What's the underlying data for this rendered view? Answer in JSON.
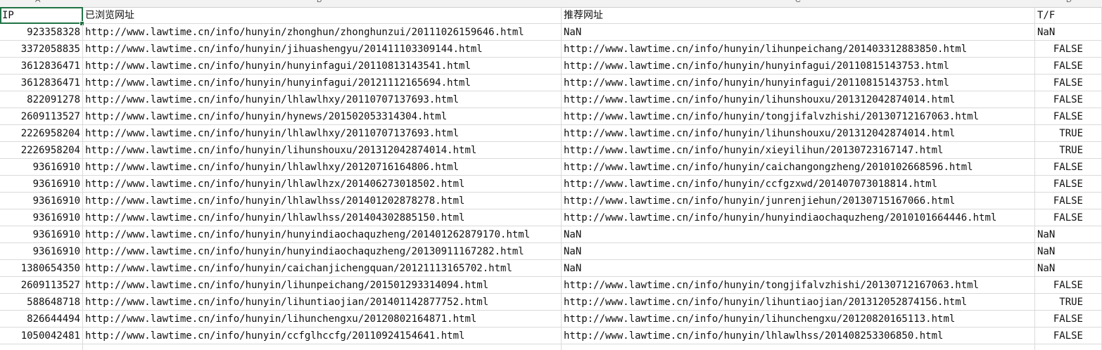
{
  "column_letters": [
    "A",
    "B",
    "C",
    "D"
  ],
  "header": {
    "ip": "IP",
    "viewed": "已浏览网址",
    "recommended": "推荐网址",
    "tf": "T/F"
  },
  "rows": [
    {
      "ip": "923358328",
      "viewed": "http://www.lawtime.cn/info/hunyin/zhonghun/zhonghunzui/20111026159646.html",
      "recommended": "NaN",
      "tf": "NaN"
    },
    {
      "ip": "3372058835",
      "viewed": "http://www.lawtime.cn/info/hunyin/jihuashengyu/201411103309144.html",
      "recommended": "http://www.lawtime.cn/info/hunyin/lihunpeichang/201403312883850.html",
      "tf": "FALSE"
    },
    {
      "ip": "3612836471",
      "viewed": "http://www.lawtime.cn/info/hunyin/hunyinfagui/20110813143541.html",
      "recommended": "http://www.lawtime.cn/info/hunyin/hunyinfagui/20110815143753.html",
      "tf": "FALSE"
    },
    {
      "ip": "3612836471",
      "viewed": "http://www.lawtime.cn/info/hunyin/hunyinfagui/20121112165694.html",
      "recommended": "http://www.lawtime.cn/info/hunyin/hunyinfagui/20110815143753.html",
      "tf": "FALSE"
    },
    {
      "ip": "822091278",
      "viewed": "http://www.lawtime.cn/info/hunyin/lhlawlhxy/20110707137693.html",
      "recommended": "http://www.lawtime.cn/info/hunyin/lihunshouxu/201312042874014.html",
      "tf": "FALSE"
    },
    {
      "ip": "2609113527",
      "viewed": "http://www.lawtime.cn/info/hunyin/hynews/201502053314304.html",
      "recommended": "http://www.lawtime.cn/info/hunyin/tongjifalvzhishi/20130712167063.html",
      "tf": "FALSE"
    },
    {
      "ip": "2226958204",
      "viewed": "http://www.lawtime.cn/info/hunyin/lhlawlhxy/20110707137693.html",
      "recommended": "http://www.lawtime.cn/info/hunyin/lihunshouxu/201312042874014.html",
      "tf": "TRUE"
    },
    {
      "ip": "2226958204",
      "viewed": "http://www.lawtime.cn/info/hunyin/lihunshouxu/201312042874014.html",
      "recommended": "http://www.lawtime.cn/info/hunyin/xieyilihun/20130723167147.html",
      "tf": "TRUE"
    },
    {
      "ip": "93616910",
      "viewed": "http://www.lawtime.cn/info/hunyin/lhlawlhxy/20120716164806.html",
      "recommended": "http://www.lawtime.cn/info/hunyin/caichangongzheng/2010102668596.html",
      "tf": "FALSE"
    },
    {
      "ip": "93616910",
      "viewed": "http://www.lawtime.cn/info/hunyin/lhlawlhzx/201406273018502.html",
      "recommended": "http://www.lawtime.cn/info/hunyin/ccfgzxwd/201407073018814.html",
      "tf": "FALSE"
    },
    {
      "ip": "93616910",
      "viewed": "http://www.lawtime.cn/info/hunyin/lhlawlhss/201401202878278.html",
      "recommended": "http://www.lawtime.cn/info/hunyin/junrenjiehun/20130715167066.html",
      "tf": "FALSE"
    },
    {
      "ip": "93616910",
      "viewed": "http://www.lawtime.cn/info/hunyin/lhlawlhss/201404302885150.html",
      "recommended": "http://www.lawtime.cn/info/hunyin/hunyindiaochaquzheng/2010101664446.html",
      "tf": "FALSE"
    },
    {
      "ip": "93616910",
      "viewed": "http://www.lawtime.cn/info/hunyin/hunyindiaochaquzheng/201401262879170.html",
      "recommended": "NaN",
      "tf": "NaN"
    },
    {
      "ip": "93616910",
      "viewed": "http://www.lawtime.cn/info/hunyin/hunyindiaochaquzheng/20130911167282.html",
      "recommended": "NaN",
      "tf": "NaN"
    },
    {
      "ip": "1380654350",
      "viewed": "http://www.lawtime.cn/info/hunyin/caichanjichengquan/20121113165702.html",
      "recommended": "NaN",
      "tf": "NaN"
    },
    {
      "ip": "2609113527",
      "viewed": "http://www.lawtime.cn/info/hunyin/lihunpeichang/201501293314094.html",
      "recommended": "http://www.lawtime.cn/info/hunyin/tongjifalvzhishi/20130712167063.html",
      "tf": "FALSE"
    },
    {
      "ip": "588648718",
      "viewed": "http://www.lawtime.cn/info/hunyin/lihuntiaojian/201401142877752.html",
      "recommended": "http://www.lawtime.cn/info/hunyin/lihuntiaojian/201312052874156.html",
      "tf": "TRUE"
    },
    {
      "ip": "826644494",
      "viewed": "http://www.lawtime.cn/info/hunyin/lihunchengxu/20120802164871.html",
      "recommended": "http://www.lawtime.cn/info/hunyin/lihunchengxu/20120820165113.html",
      "tf": "FALSE"
    },
    {
      "ip": "1050042481",
      "viewed": "http://www.lawtime.cn/info/hunyin/ccfglhccfg/20110924154641.html",
      "recommended": "http://www.lawtime.cn/info/hunyin/lhlawlhss/201408253306850.html",
      "tf": "FALSE"
    }
  ]
}
